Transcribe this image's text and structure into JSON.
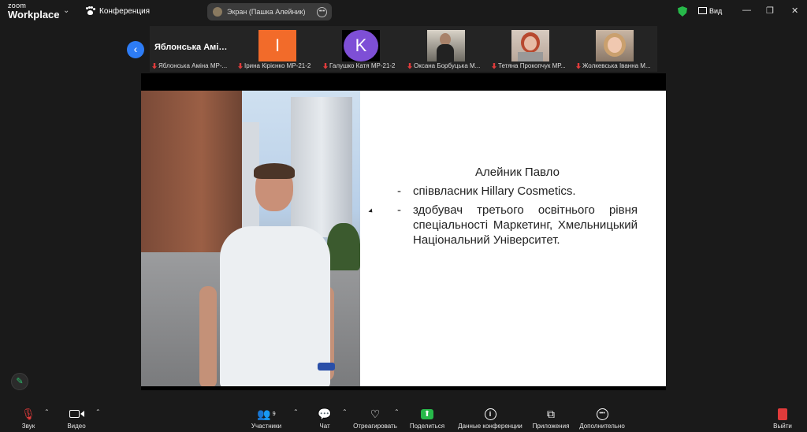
{
  "app": {
    "brand_top": "zoom",
    "brand_bottom": "Workplace",
    "meeting_label": "Конференция"
  },
  "share_pill": {
    "label": "Экран (Пашка Алейник)"
  },
  "topbar": {
    "view_label": "Вид"
  },
  "participants": {
    "active_name": "Яблонська Амі…",
    "tiles": [
      {
        "caption": "Яблонська Аміна МР-...",
        "letter": "",
        "color": ""
      },
      {
        "caption": "Ірина Кірієнко МР-21-2",
        "letter": "I",
        "color": "#f26b2a"
      },
      {
        "caption": "Галушко Катя МР-21-2",
        "letter": "K",
        "color": "#7e4fd6"
      },
      {
        "caption": "Оксана Борбуцька М...",
        "letter": "",
        "color": ""
      },
      {
        "caption": "Тетяна Прокопчук МР...",
        "letter": "",
        "color": ""
      },
      {
        "caption": "Жолкевська Іванна М...",
        "letter": "",
        "color": ""
      }
    ]
  },
  "slide": {
    "title": "Алейник Павло",
    "bullets": [
      "співвласник Hillary Cosmetics.",
      "здобувач третього освітнього рівня спеціальності Маркетинг, Хмельницький Національний Університет."
    ],
    "dash": "-"
  },
  "toolbar": {
    "audio": "Звук",
    "video": "Видео",
    "participants": "Участники",
    "participants_count": "9",
    "chat": "Чат",
    "react": "Отреагировать",
    "share": "Поделиться",
    "info": "Данные конференции",
    "apps": "Приложения",
    "more": "Дополнительно",
    "leave": "Выйти"
  }
}
